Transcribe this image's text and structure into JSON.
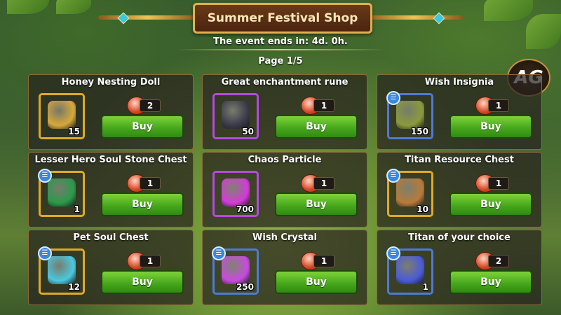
{
  "header": {
    "title": "Summer Festival Shop",
    "event_text": "The event ends in: 4d. 0h.",
    "page_text": "Page 1/5"
  },
  "logo": {
    "text": "AG"
  },
  "items": [
    {
      "name": "Honey Nesting Doll",
      "quantity": "15",
      "cost": "2",
      "buy_label": "Buy",
      "frame": "gold",
      "list_badge": false,
      "icon": "bee-doll-icon",
      "art_color": "#d8a83a"
    },
    {
      "name": "Great enchantment rune",
      "quantity": "50",
      "cost": "1",
      "buy_label": "Buy",
      "frame": "purple",
      "list_badge": false,
      "icon": "rune-icon",
      "art_color": "#3a3a4a"
    },
    {
      "name": "Wish Insignia",
      "quantity": "150",
      "cost": "1",
      "buy_label": "Buy",
      "frame": "blue",
      "list_badge": true,
      "icon": "insignia-chest-icon",
      "art_color": "#8a9a3a"
    },
    {
      "name": "Lesser Hero Soul Stone Chest",
      "quantity": "1",
      "cost": "1",
      "buy_label": "Buy",
      "frame": "gold",
      "list_badge": true,
      "icon": "green-chest-icon",
      "art_color": "#2a9a4a"
    },
    {
      "name": "Chaos Particle",
      "quantity": "700",
      "cost": "1",
      "buy_label": "Buy",
      "frame": "purple",
      "list_badge": false,
      "icon": "cube-icon",
      "art_color": "#d43ad8"
    },
    {
      "name": "Titan Resource Chest",
      "quantity": "10",
      "cost": "1",
      "buy_label": "Buy",
      "frame": "gold",
      "list_badge": true,
      "icon": "titan-chest-icon",
      "art_color": "#b87a3a"
    },
    {
      "name": "Pet Soul Chest",
      "quantity": "12",
      "cost": "1",
      "buy_label": "Buy",
      "frame": "gold",
      "list_badge": true,
      "icon": "pet-chest-icon",
      "art_color": "#4ac8e0"
    },
    {
      "name": "Wish Crystal",
      "quantity": "250",
      "cost": "1",
      "buy_label": "Buy",
      "frame": "blue",
      "list_badge": true,
      "icon": "crystal-icon",
      "art_color": "#c84ae0"
    },
    {
      "name": "Titan of your choice",
      "quantity": "1",
      "cost": "2",
      "buy_label": "Buy",
      "frame": "blue",
      "list_badge": true,
      "icon": "titan-icon",
      "art_color": "#4a5ad8"
    }
  ],
  "colors": {
    "frame_gold": "#e0a92a",
    "frame_purple": "#b44ae0",
    "frame_blue": "#4f7ad8",
    "buy_green": "#48a81c"
  }
}
